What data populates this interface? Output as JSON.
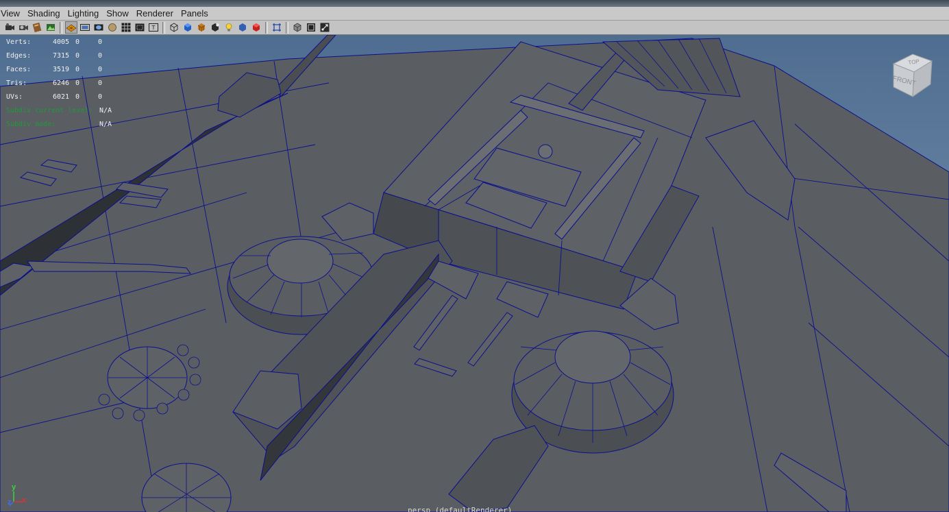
{
  "menubar": {
    "items": [
      "View",
      "Shading",
      "Lighting",
      "Show",
      "Renderer",
      "Panels"
    ]
  },
  "toolbar": {
    "icons": [
      "select-camera-icon",
      "camera-attributes-icon",
      "bookmarks-icon",
      "image-plane-icon",
      "grid-icon",
      "film-gate-icon",
      "resolution-gate-icon",
      "gate-mask-icon",
      "field-chart-icon",
      "safe-action-icon",
      "safe-title-icon",
      "wireframe-icon",
      "smooth-shade-icon",
      "textured-icon",
      "use-all-lights-icon",
      "shadows-icon",
      "xray-icon",
      "isolate-select-icon",
      "frame-selection-icon",
      "high-quality-icon",
      "backface-icon",
      "resize-icon"
    ]
  },
  "hud": {
    "rows": [
      {
        "label": "Verts:",
        "value": "4005",
        "sel": "0",
        "uv": "0"
      },
      {
        "label": "Edges:",
        "value": "7315",
        "sel": "0",
        "uv": "0"
      },
      {
        "label": "Faces:",
        "value": "3519",
        "sel": "0",
        "uv": "0"
      },
      {
        "label": "Tris:",
        "value": "6246",
        "sel": "0",
        "uv": "0"
      },
      {
        "label": "UVs:",
        "value": "6021",
        "sel": "0",
        "uv": "0"
      }
    ],
    "subdiv_level_label": "Subdiv current level:",
    "subdiv_level_value": "N/A",
    "subdiv_mode_label": "Subdiv mode:",
    "subdiv_mode_value": "N/A"
  },
  "viewcube": {
    "top": "TOP",
    "front": "FRONT"
  },
  "camera_label": "persp (defaultRenderer)",
  "axis": {
    "y": "y",
    "z": "z",
    "x": "x"
  },
  "colors": {
    "mesh_face": "#5a5e63",
    "mesh_dark": "#3c3f43",
    "wire": "#0a0f8c",
    "background": "#6f87a3",
    "hud_green": "#1ea03c"
  }
}
